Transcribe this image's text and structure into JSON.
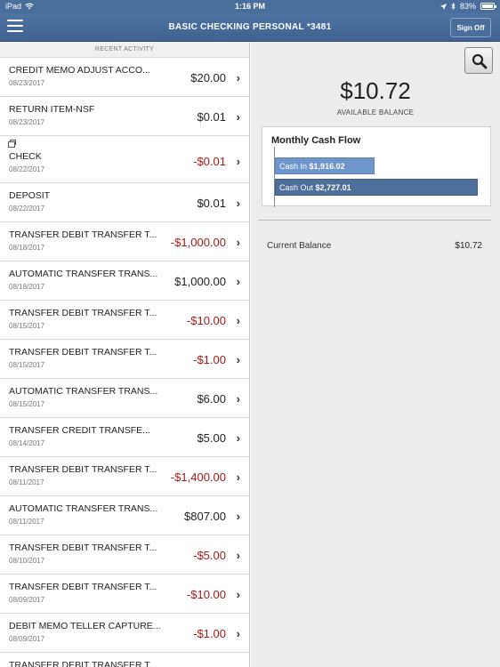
{
  "statusbar": {
    "device": "iPad",
    "time": "1:16 PM",
    "battery_label": "83%",
    "battery_level": 0.83
  },
  "navbar": {
    "title": "BASIC CHECKING PERSONAL *3481",
    "signoff_label": "Sign Off"
  },
  "activity": {
    "header": "RECENT ACTIVITY",
    "transactions": [
      {
        "desc": "CREDIT MEMO ADJUST ACCO...",
        "date": "08/23/2017",
        "amount": "$20.00",
        "negative": false
      },
      {
        "desc": "RETURN ITEM-NSF",
        "date": "08/23/2017",
        "amount": "$0.01",
        "negative": false
      },
      {
        "desc": "CHECK",
        "date": "08/22/2017",
        "amount": "-$0.01",
        "negative": true,
        "has_image": true
      },
      {
        "desc": "DEPOSIT",
        "date": "08/22/2017",
        "amount": "$0.01",
        "negative": false
      },
      {
        "desc": "TRANSFER DEBIT TRANSFER T...",
        "date": "08/18/2017",
        "amount": "-$1,000.00",
        "negative": true
      },
      {
        "desc": "AUTOMATIC TRANSFER TRANS...",
        "date": "08/18/2017",
        "amount": "$1,000.00",
        "negative": false
      },
      {
        "desc": "TRANSFER DEBIT TRANSFER T...",
        "date": "08/15/2017",
        "amount": "-$10.00",
        "negative": true
      },
      {
        "desc": "TRANSFER DEBIT TRANSFER T...",
        "date": "08/15/2017",
        "amount": "-$1.00",
        "negative": true
      },
      {
        "desc": "AUTOMATIC TRANSFER TRANS...",
        "date": "08/15/2017",
        "amount": "$6.00",
        "negative": false
      },
      {
        "desc": "TRANSFER CREDIT TRANSFE...",
        "date": "08/14/2017",
        "amount": "$5.00",
        "negative": false
      },
      {
        "desc": "TRANSFER DEBIT TRANSFER T...",
        "date": "08/11/2017",
        "amount": "-$1,400.00",
        "negative": true
      },
      {
        "desc": "AUTOMATIC TRANSFER TRANS...",
        "date": "08/11/2017",
        "amount": "$807.00",
        "negative": false
      },
      {
        "desc": "TRANSFER DEBIT TRANSFER T...",
        "date": "08/10/2017",
        "amount": "-$5.00",
        "negative": true
      },
      {
        "desc": "TRANSFER DEBIT TRANSFER T...",
        "date": "08/09/2017",
        "amount": "-$10.00",
        "negative": true
      },
      {
        "desc": "DEBIT MEMO TELLER CAPTURE...",
        "date": "08/09/2017",
        "amount": "-$1.00",
        "negative": true
      },
      {
        "desc": "TRANSFER DEBIT TRANSFER T...",
        "date": "",
        "amount": "",
        "negative": true
      }
    ]
  },
  "summary": {
    "balance": "$10.72",
    "balance_label": "AVAILABLE BALANCE",
    "current_balance_label": "Current Balance",
    "current_balance_value": "$10.72"
  },
  "cashflow": {
    "title": "Monthly Cash Flow",
    "in_label": "Cash In",
    "in_value_text": "$1,916.02",
    "in_value": 1916.02,
    "out_label": "Cash Out",
    "out_value_text": "$2,727.01",
    "out_value": 2727.01
  },
  "colors": {
    "nav": "#4a6e9c",
    "negative": "#a11a1a",
    "cash_in": "#6e95cc",
    "cash_out": "#4f6f9b"
  }
}
